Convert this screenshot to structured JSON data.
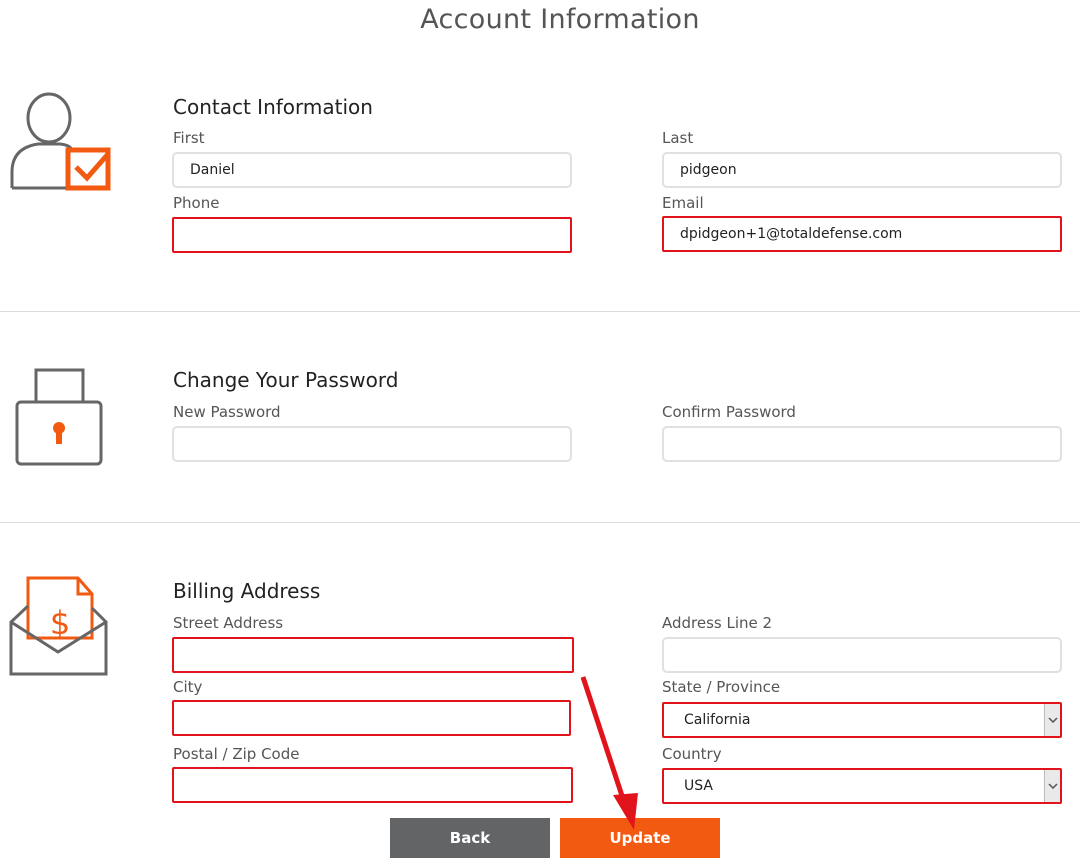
{
  "page": {
    "title": "Account Information"
  },
  "contact": {
    "title": "Contact Information",
    "first_label": "First",
    "first_value": "Daniel",
    "last_label": "Last",
    "last_value": "pidgeon",
    "phone_label": "Phone",
    "phone_value": "",
    "email_label": "Email",
    "email_value": "dpidgeon+1@totaldefense.com"
  },
  "password": {
    "title": "Change Your Password",
    "new_label": "New Password",
    "confirm_label": "Confirm Password"
  },
  "billing": {
    "title": "Billing Address",
    "street_label": "Street Address",
    "address2_label": "Address Line 2",
    "city_label": "City",
    "state_label": "State / Province",
    "state_value": "California",
    "zip_label": "Postal / Zip Code",
    "country_label": "Country",
    "country_value": "USA"
  },
  "buttons": {
    "back": "Back",
    "update": "Update"
  },
  "colors": {
    "accent": "#f25a12",
    "error": "#e2141b",
    "icon_gray": "#666666",
    "back": "#636466"
  }
}
